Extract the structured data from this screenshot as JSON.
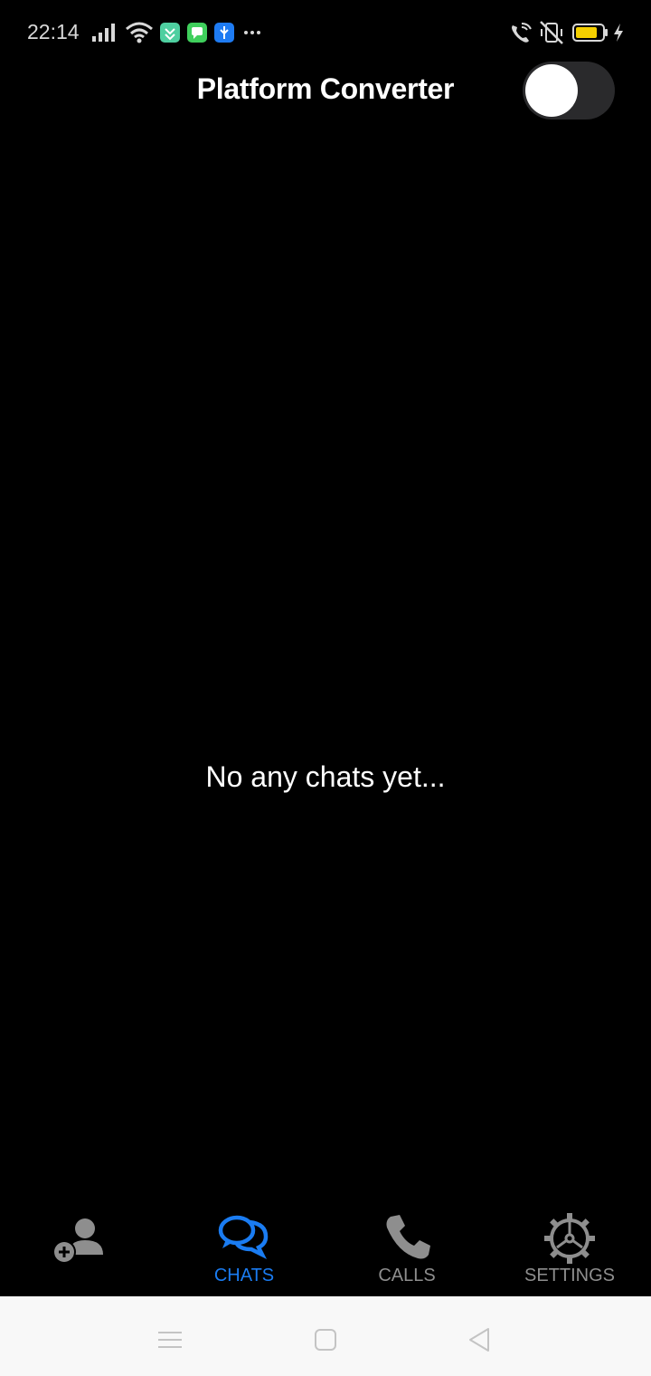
{
  "status_bar": {
    "time": "22:14",
    "left_icons": [
      "signal-icon",
      "wifi-icon",
      "app-notification-icon",
      "message-notification-icon",
      "usb-icon",
      "more-notifications-icon"
    ],
    "right_icons": [
      "wifi-calling-icon",
      "vibrate-off-icon",
      "battery-icon",
      "charging-icon"
    ]
  },
  "header": {
    "title": "Platform Converter",
    "toggle_state": "off"
  },
  "main": {
    "empty_message": "No any chats yet..."
  },
  "bottom_nav": {
    "items": [
      {
        "name": "add-contact",
        "label": "",
        "icon": "add-person-icon",
        "active": false
      },
      {
        "name": "chats",
        "label": "CHATS",
        "icon": "chat-bubbles-icon",
        "active": true
      },
      {
        "name": "calls",
        "label": "CALLS",
        "icon": "phone-icon",
        "active": false
      },
      {
        "name": "settings",
        "label": "SETTINGS",
        "icon": "gear-icon",
        "active": false
      }
    ]
  },
  "system_nav": {
    "buttons": [
      "menu-icon",
      "home-icon",
      "back-icon"
    ]
  },
  "colors": {
    "background": "#000000",
    "accent": "#1a7cf2",
    "inactive": "#8e8e8e",
    "toggle_track": "#2a2a2c",
    "system_nav_bg": "#f8f8f8"
  }
}
